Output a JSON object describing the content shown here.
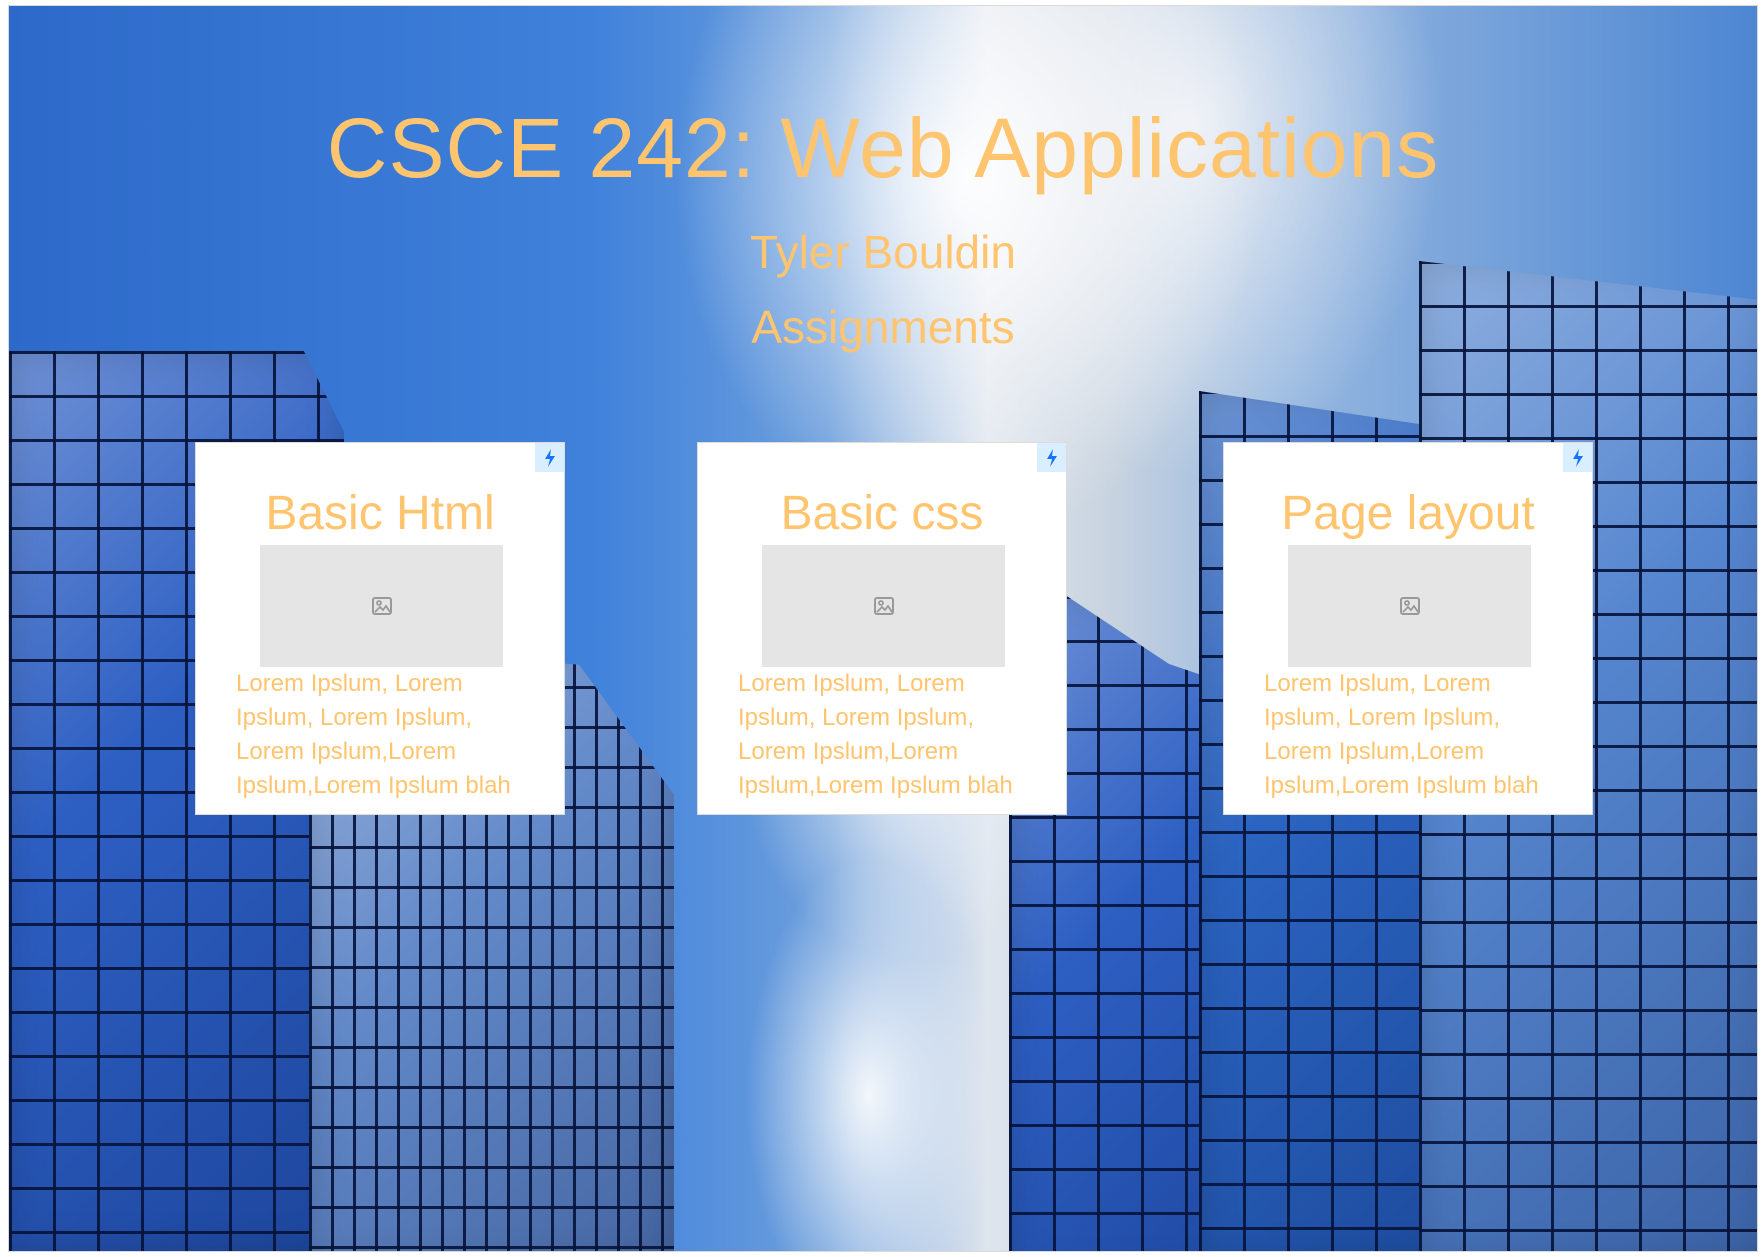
{
  "page": {
    "title": "CSCE 242: Web Applications",
    "author": "Tyler Bouldin",
    "section_heading": "Assignments"
  },
  "cards": [
    {
      "title": "Basic Html",
      "description": "Lorem Ipslum, Lorem Ipslum, Lorem Ipslum, Lorem Ipslum,Lorem Ipslum,Lorem Ipslum blah",
      "badge_icon": "bolt-icon",
      "image_icon": "image-icon"
    },
    {
      "title": "Basic css",
      "description": "Lorem Ipslum, Lorem Ipslum, Lorem Ipslum, Lorem Ipslum,Lorem Ipslum,Lorem Ipslum blah",
      "badge_icon": "bolt-icon",
      "image_icon": "image-icon"
    },
    {
      "title": "Page layout",
      "description": "Lorem Ipslum, Lorem Ipslum, Lorem Ipslum, Lorem Ipslum,Lorem Ipslum,Lorem Ipslum blah",
      "badge_icon": "bolt-icon",
      "image_icon": "image-icon"
    }
  ],
  "colors": {
    "heading_text": "#ffc46e",
    "card_background": "#ffffff",
    "placeholder_background": "#e5e5e5",
    "badge_background": "#d9efff",
    "badge_icon": "#1673ff",
    "sky_blue": "#3f81db",
    "building_blue": "#2d5fc3"
  }
}
